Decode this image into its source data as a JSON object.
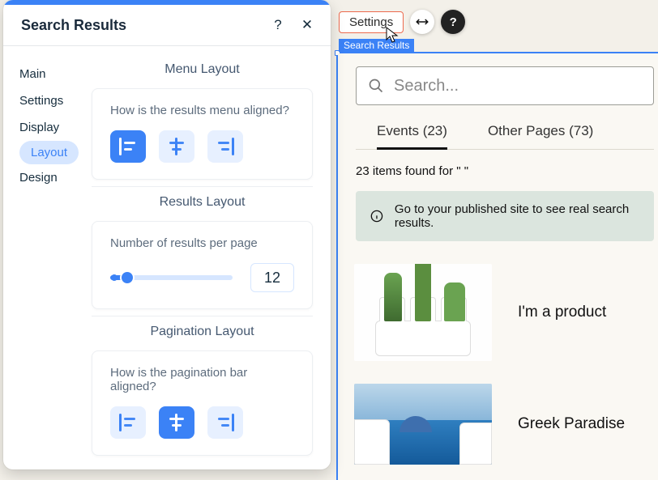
{
  "panel": {
    "title": "Search Results",
    "help": "?",
    "close": "✕"
  },
  "sidebar": {
    "items": [
      {
        "label": "Main"
      },
      {
        "label": "Settings"
      },
      {
        "label": "Display"
      },
      {
        "label": "Layout"
      },
      {
        "label": "Design"
      }
    ]
  },
  "layout": {
    "menu": {
      "heading": "Menu Layout",
      "question": "How is the results menu aligned?"
    },
    "results": {
      "heading": "Results Layout",
      "label": "Number of results per page",
      "value": "12"
    },
    "pagination": {
      "heading": "Pagination Layout",
      "question": "How is the pagination bar aligned?"
    }
  },
  "toolbar": {
    "settings": "Settings",
    "help_glyph": "?"
  },
  "chip": "Search Results",
  "search": {
    "placeholder": "Search..."
  },
  "tabs": {
    "events": "Events (23)",
    "other": "Other Pages (73)"
  },
  "status_text": "23 items found for \" \"",
  "notice": "Go to your published site to see real search results.",
  "results_list": {
    "r1": "I'm a product",
    "r2": "Greek Paradise"
  }
}
